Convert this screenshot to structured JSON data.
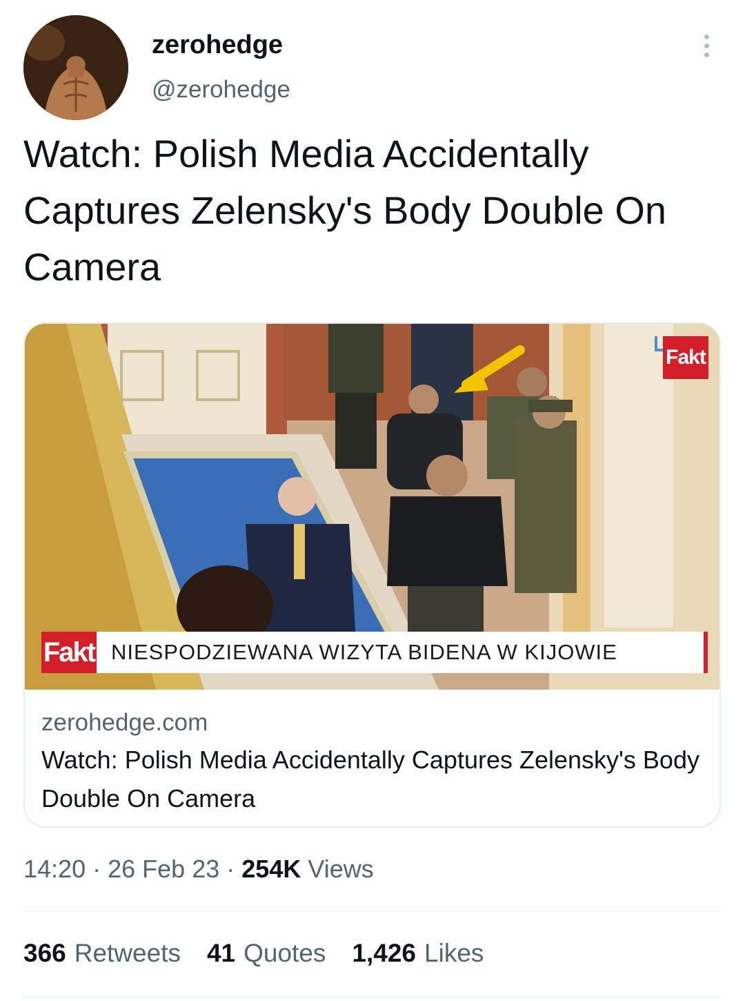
{
  "author": {
    "display_name": "zerohedge",
    "handle": "@zerohedge"
  },
  "tweet": {
    "text": "Watch: Polish Media Accidentally Captures Zelensky's Body Double On Camera"
  },
  "card": {
    "image": {
      "corner_logo": "Fakt",
      "lower_third_logo": "Fakt",
      "lower_third_text": "NIESPODZIEWANA WIZYTA BIDENA W KIJOWIE"
    },
    "domain": "zerohedge.com",
    "title": "Watch: Polish Media Accidentally Captures Zelensky's Body Double On Camera"
  },
  "meta": {
    "time": "14:20",
    "separator": "·",
    "date": "26 Feb 23",
    "views_count": "254K",
    "views_label": "Views"
  },
  "stats": {
    "retweets_count": "366",
    "retweets_label": "Retweets",
    "quotes_count": "41",
    "quotes_label": "Quotes",
    "likes_count": "1,426",
    "likes_label": "Likes"
  },
  "colors": {
    "text_primary": "#0f1419",
    "text_secondary": "#536471",
    "fakt_red": "#d41f2b",
    "arrow_yellow": "#f2c500"
  }
}
